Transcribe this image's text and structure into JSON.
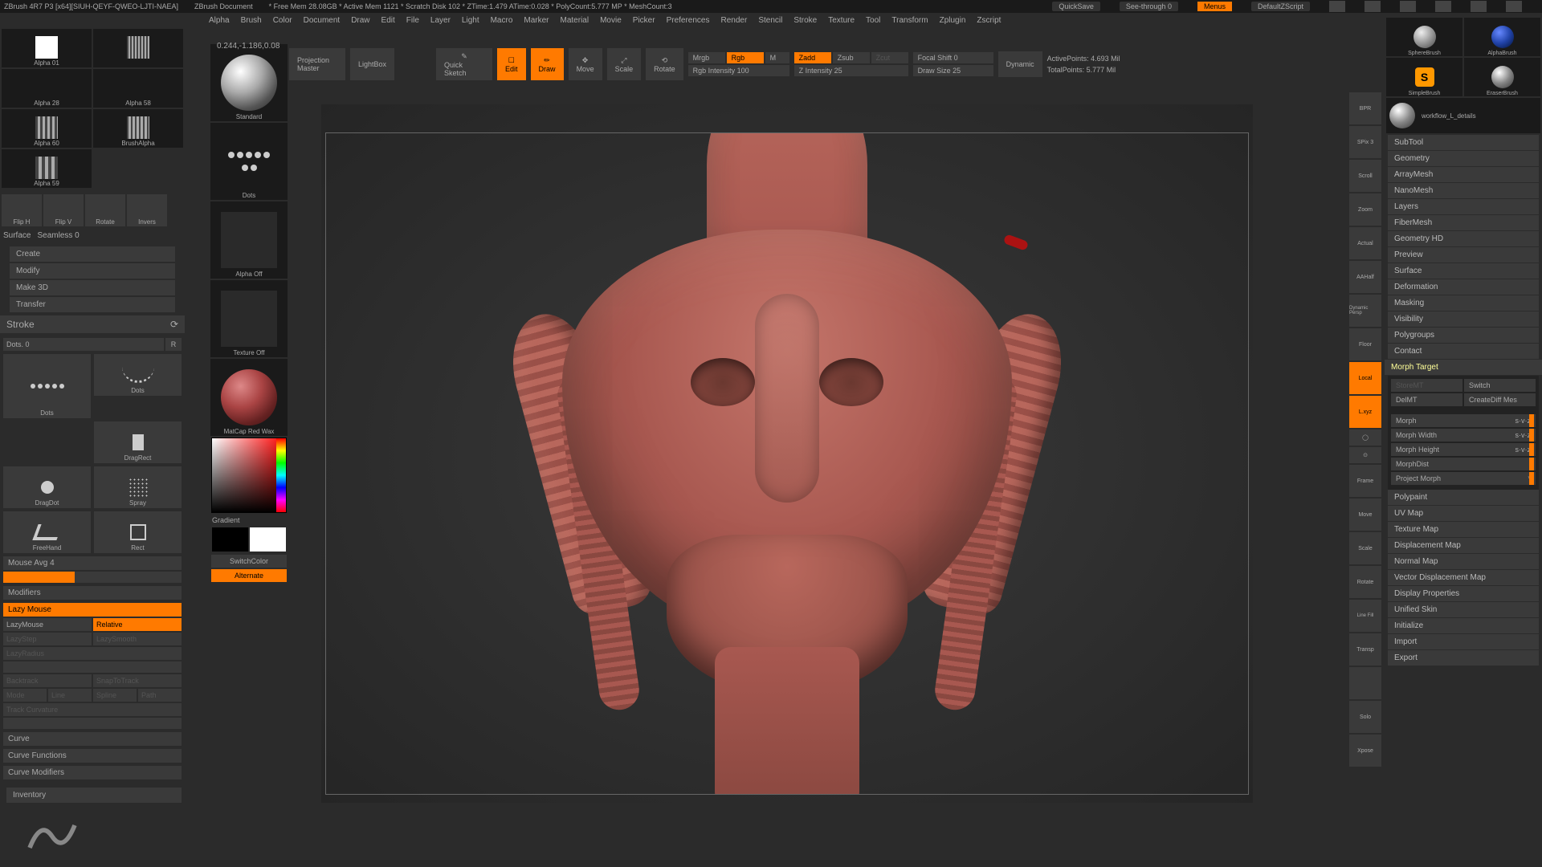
{
  "title": {
    "app": "ZBrush 4R7 P3 [x64][SIUH-QEYF-QWEO-LJTI-NAEA]",
    "doc": "ZBrush Document",
    "stats": "* Free Mem 28.08GB * Active Mem 1121 * Scratch Disk 102 * ZTime:1.479 ATime:0.028 * PolyCount:5.777 MP * MeshCount:3",
    "quicksave": "QuickSave",
    "seethrough": "See-through  0",
    "menus": "Menus",
    "defaultz": "DefaultZScript"
  },
  "menu": [
    "Alpha",
    "Brush",
    "Color",
    "Document",
    "Draw",
    "Edit",
    "File",
    "Layer",
    "Light",
    "Macro",
    "Marker",
    "Material",
    "Movie",
    "Picker",
    "Preferences",
    "Render",
    "Stencil",
    "Stroke",
    "Texture",
    "Tool",
    "Transform",
    "Zplugin",
    "Zscript"
  ],
  "coords": "0.244,-1.186,0.08",
  "alphas": [
    "Alpha 28",
    "Alpha 58",
    "Alpha 60",
    "BrushAlpha",
    "Alpha 59",
    "Alpha 01"
  ],
  "left_icons": [
    "Flip H",
    "Flip V",
    "Rotate",
    "Invers"
  ],
  "surface": {
    "label": "Surface",
    "seamless": "Seamless 0"
  },
  "create_menu": [
    "Create",
    "Modify",
    "Make 3D",
    "Transfer"
  ],
  "stroke": {
    "header": "Stroke",
    "dots": "Dots. 0",
    "r": "R",
    "types": [
      "Dots",
      "Dots",
      "DragDot",
      "Spray",
      "FreeHand",
      "Rect"
    ],
    "mouseavg": "Mouse Avg 4",
    "modifiers": "Modifiers",
    "lazymouse": "Lazy Mouse",
    "lazy_buttons": [
      [
        "LazyMouse",
        "Relative"
      ],
      [
        "LazyStep",
        "LazySmooth"
      ]
    ],
    "lazyradius": "LazyRadius",
    "backtrack": [
      "Backtrack",
      "SnapToTrack"
    ],
    "modes": [
      "Mode",
      "Line",
      "Spline",
      "Path"
    ],
    "trackcurv": "Track Curvature",
    "curves": [
      "Curve",
      "Curve Functions",
      "Curve Modifiers"
    ]
  },
  "inventory": "Inventory",
  "brush_strip": {
    "standard": "Standard",
    "dots": "Dots",
    "alphaoff": "Alpha  Off",
    "textureoff": "Texture  Off",
    "matcap": "MatCap Red Wax",
    "gradient": "Gradient",
    "switchcolor": "SwitchColor",
    "alternate": "Alternate"
  },
  "toolbar": {
    "projection": "Projection Master",
    "lightbox": "LightBox",
    "quicksketch": "Quick Sketch",
    "edit": "Edit",
    "draw": "Draw",
    "move": "Move",
    "scale": "Scale",
    "rotate": "Rotate",
    "mrgb": "Mrgb",
    "rgb": "Rgb",
    "m": "M",
    "rgbint": "Rgb Intensity 100",
    "zadd": "Zadd",
    "zsub": "Zsub",
    "zcut": "Zcut",
    "zint": "Z Intensity 25",
    "focal": "Focal Shift 0",
    "drawsize": "Draw Size 25",
    "dynamic": "Dynamic",
    "activepoints": "ActivePoints:  4.693 Mil",
    "totalpoints": "TotalPoints:  5.777 Mil"
  },
  "right_tb": [
    "BPR",
    "SPix 3",
    "Scroll",
    "Zoom",
    "Actual",
    "AAHalf",
    "Dynamic Persp",
    "Floor",
    "Local",
    "",
    "",
    "Frame",
    "Move",
    "Scale",
    "Rotate",
    "Line Fill",
    "Transp",
    "",
    "Solo",
    "Xpose"
  ],
  "right_tb_active": [
    12,
    14
  ],
  "right_brushes": [
    "SphereBrush",
    "AlphaBrush",
    "SimpleBrush",
    "EraserBrush",
    "workflow_L_details",
    "",
    "workflow_L_details",
    ""
  ],
  "right_panel": {
    "sections_top": [
      "SubTool",
      "Geometry",
      "ArrayMesh",
      "NanoMesh",
      "Layers",
      "FiberMesh",
      "Geometry HD",
      "Preview",
      "Surface",
      "Deformation",
      "Masking",
      "Visibility",
      "Polygroups",
      "Contact"
    ],
    "morph_header": "Morph Target",
    "morph_row1": [
      "StoreMT",
      "Switch"
    ],
    "morph_row2": [
      "DelMT",
      "CreateDiff Mes"
    ],
    "morph_sliders": [
      "Morph",
      "Morph Width",
      "Morph Height",
      "MorphDist",
      "Project Morph"
    ],
    "morph_val": "s·v·z",
    "sections_bottom": [
      "Polypaint",
      "UV Map",
      "Texture Map",
      "Displacement Map",
      "Normal Map",
      "Vector Displacement Map",
      "Display Properties",
      "Unified Skin",
      "Initialize",
      "Import",
      "Export"
    ]
  }
}
